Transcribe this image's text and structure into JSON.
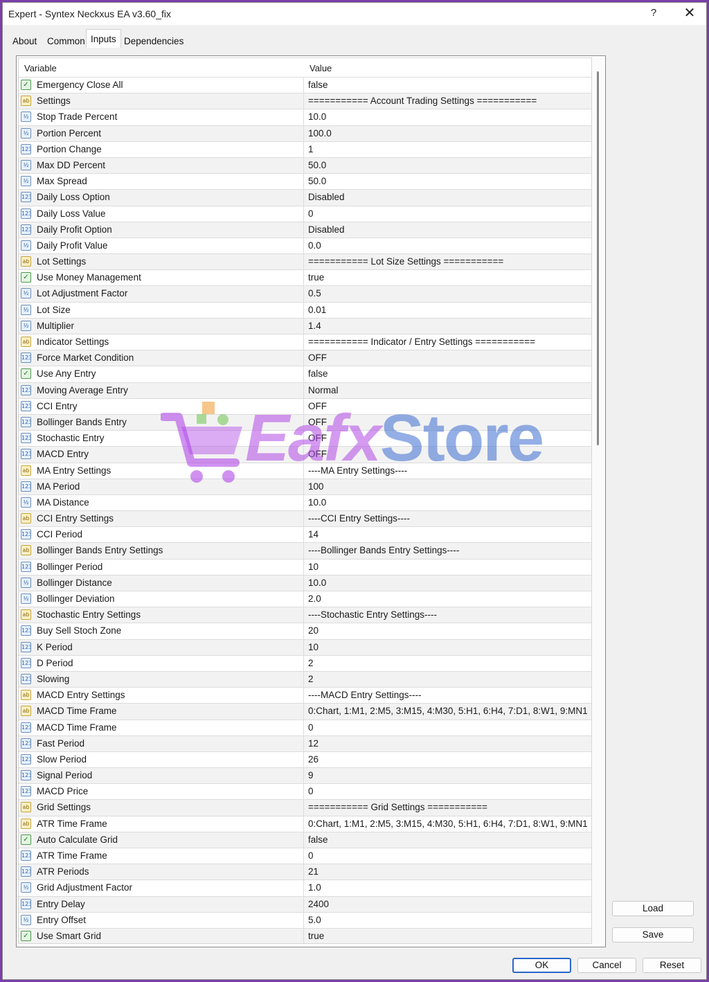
{
  "window": {
    "title": "Expert - Syntex Neckxus EA v3.60_fix",
    "help_label": "?",
    "close_label": "✕"
  },
  "tabs": [
    {
      "label": "About",
      "active": false
    },
    {
      "label": "Common",
      "active": false
    },
    {
      "label": "Inputs",
      "active": true
    },
    {
      "label": "Dependencies",
      "active": false
    }
  ],
  "grid": {
    "headers": {
      "variable": "Variable",
      "value": "Value"
    },
    "rows": [
      {
        "type": "bool",
        "variable": "Emergency Close All",
        "value": "false"
      },
      {
        "type": "ab",
        "variable": "Settings",
        "value": "=========== Account Trading Settings ==========="
      },
      {
        "type": "num",
        "variable": "Stop Trade Percent",
        "value": "10.0"
      },
      {
        "type": "num",
        "variable": "Portion Percent",
        "value": "100.0"
      },
      {
        "type": "int",
        "variable": "Portion Change",
        "value": "1"
      },
      {
        "type": "num",
        "variable": "Max DD Percent",
        "value": "50.0"
      },
      {
        "type": "num",
        "variable": "Max Spread",
        "value": "50.0"
      },
      {
        "type": "int",
        "variable": "Daily Loss Option",
        "value": "Disabled"
      },
      {
        "type": "int",
        "variable": "Daily Loss Value",
        "value": "0"
      },
      {
        "type": "int",
        "variable": "Daily Profit Option",
        "value": "Disabled"
      },
      {
        "type": "num",
        "variable": "Daily Profit Value",
        "value": "0.0"
      },
      {
        "type": "ab",
        "variable": "Lot Settings",
        "value": "=========== Lot Size Settings ==========="
      },
      {
        "type": "bool",
        "variable": "Use Money Management",
        "value": "true"
      },
      {
        "type": "num",
        "variable": "Lot Adjustment Factor",
        "value": "0.5"
      },
      {
        "type": "num",
        "variable": "Lot Size",
        "value": "0.01"
      },
      {
        "type": "num",
        "variable": "Multiplier",
        "value": "1.4"
      },
      {
        "type": "ab",
        "variable": "Indicator Settings",
        "value": "=========== Indicator / Entry Settings ==========="
      },
      {
        "type": "int",
        "variable": "Force Market Condition",
        "value": "OFF"
      },
      {
        "type": "bool",
        "variable": "Use Any Entry",
        "value": "false"
      },
      {
        "type": "int",
        "variable": "Moving Average Entry",
        "value": "Normal"
      },
      {
        "type": "int",
        "variable": "CCI Entry",
        "value": "OFF"
      },
      {
        "type": "int",
        "variable": "Bollinger Bands Entry",
        "value": "OFF"
      },
      {
        "type": "int",
        "variable": "Stochastic Entry",
        "value": "OFF"
      },
      {
        "type": "int",
        "variable": "MACD Entry",
        "value": "OFF"
      },
      {
        "type": "ab",
        "variable": "MA Entry Settings",
        "value": "----MA Entry Settings----"
      },
      {
        "type": "int",
        "variable": "MA Period",
        "value": "100"
      },
      {
        "type": "num",
        "variable": "MA Distance",
        "value": "10.0"
      },
      {
        "type": "ab",
        "variable": "CCI Entry Settings",
        "value": "----CCI Entry Settings----"
      },
      {
        "type": "int",
        "variable": "CCI Period",
        "value": "14"
      },
      {
        "type": "ab",
        "variable": "Bollinger Bands Entry Settings",
        "value": "----Bollinger Bands Entry Settings----"
      },
      {
        "type": "int",
        "variable": "Bollinger Period",
        "value": "10"
      },
      {
        "type": "num",
        "variable": "Bollinger Distance",
        "value": "10.0"
      },
      {
        "type": "num",
        "variable": "Bollinger Deviation",
        "value": "2.0"
      },
      {
        "type": "ab",
        "variable": "Stochastic Entry Settings",
        "value": "----Stochastic Entry Settings----"
      },
      {
        "type": "int",
        "variable": "Buy Sell Stoch Zone",
        "value": "20"
      },
      {
        "type": "int",
        "variable": "K Period",
        "value": "10"
      },
      {
        "type": "int",
        "variable": "D Period",
        "value": "2"
      },
      {
        "type": "int",
        "variable": "Slowing",
        "value": "2"
      },
      {
        "type": "ab",
        "variable": "MACD Entry Settings",
        "value": "----MACD Entry Settings----"
      },
      {
        "type": "ab",
        "variable": "MACD Time Frame",
        "value": "0:Chart, 1:M1, 2:M5, 3:M15, 4:M30, 5:H1, 6:H4, 7:D1, 8:W1, 9:MN1"
      },
      {
        "type": "int",
        "variable": "MACD Time Frame",
        "value": "0"
      },
      {
        "type": "int",
        "variable": "Fast Period",
        "value": "12"
      },
      {
        "type": "int",
        "variable": "Slow Period",
        "value": "26"
      },
      {
        "type": "int",
        "variable": "Signal Period",
        "value": "9"
      },
      {
        "type": "int",
        "variable": "MACD Price",
        "value": "0"
      },
      {
        "type": "ab",
        "variable": "Grid Settings",
        "value": "=========== Grid Settings ==========="
      },
      {
        "type": "ab",
        "variable": "ATR Time Frame",
        "value": "0:Chart, 1:M1, 2:M5, 3:M15, 4:M30, 5:H1, 6:H4, 7:D1, 8:W1, 9:MN1"
      },
      {
        "type": "bool",
        "variable": "Auto Calculate Grid",
        "value": "false"
      },
      {
        "type": "int",
        "variable": "ATR Time Frame",
        "value": "0"
      },
      {
        "type": "int",
        "variable": "ATR Periods",
        "value": "21"
      },
      {
        "type": "num",
        "variable": "Grid Adjustment Factor",
        "value": "1.0"
      },
      {
        "type": "int",
        "variable": "Entry Delay",
        "value": "2400"
      },
      {
        "type": "num",
        "variable": "Entry Offset",
        "value": "5.0"
      },
      {
        "type": "bool",
        "variable": "Use Smart Grid",
        "value": "true"
      }
    ]
  },
  "icons": {
    "ab": "ab",
    "num": "½",
    "int": "123",
    "bool": "✓"
  },
  "buttons": {
    "load": "Load",
    "save": "Save",
    "ok": "OK",
    "cancel": "Cancel",
    "reset": "Reset"
  },
  "watermark": {
    "part1": "Eafx",
    "part2": "Store"
  }
}
